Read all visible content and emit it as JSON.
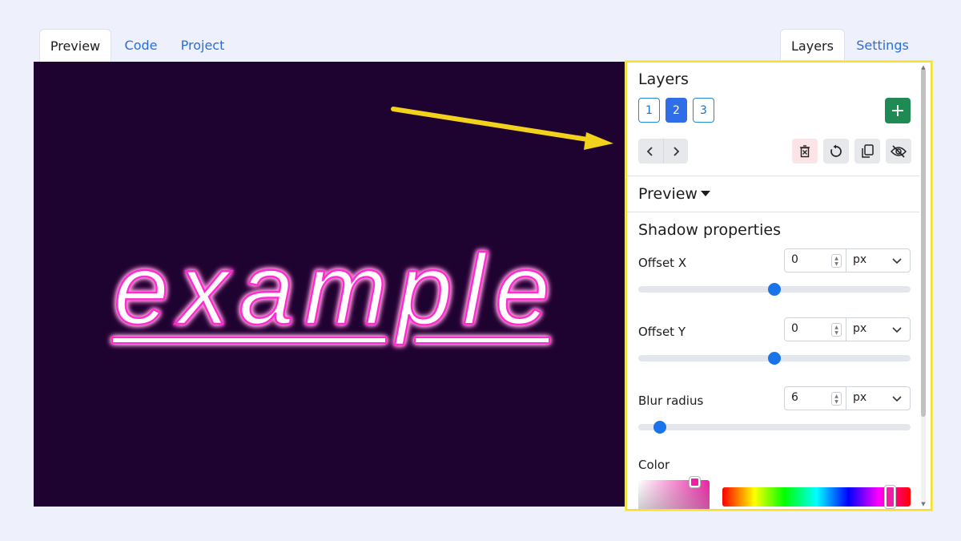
{
  "tabs_left": [
    {
      "label": "Preview",
      "active": true
    },
    {
      "label": "Code",
      "active": false
    },
    {
      "label": "Project",
      "active": false
    }
  ],
  "tabs_right": [
    {
      "label": "Layers",
      "active": true
    },
    {
      "label": "Settings",
      "active": false
    }
  ],
  "canvas": {
    "text": "example",
    "background": "#1e0330",
    "glow_color": "#ff2bd0"
  },
  "panel": {
    "layers_heading": "Layers",
    "layer_buttons": [
      "1",
      "2",
      "3"
    ],
    "active_layer": "2",
    "add_label": "+",
    "nav_prev": "‹",
    "nav_next": "›",
    "tools": [
      "delete-layer-icon",
      "reset-icon",
      "duplicate-icon",
      "hide-icon"
    ],
    "preview_heading": "Preview",
    "shadow_heading": "Shadow properties",
    "fields": [
      {
        "label": "Offset X",
        "value": "0",
        "unit": "px",
        "slider_fraction": 0.5
      },
      {
        "label": "Offset Y",
        "value": "0",
        "unit": "px",
        "slider_fraction": 0.5
      },
      {
        "label": "Blur radius",
        "value": "6",
        "unit": "px",
        "slider_fraction": 0.06
      }
    ],
    "color_label": "Color",
    "selected_color": "#ee1fa6"
  },
  "colors": {
    "accent_blue": "#2f6ee6",
    "add_green": "#1f8a54",
    "highlight_yellow": "#f3e13a"
  }
}
